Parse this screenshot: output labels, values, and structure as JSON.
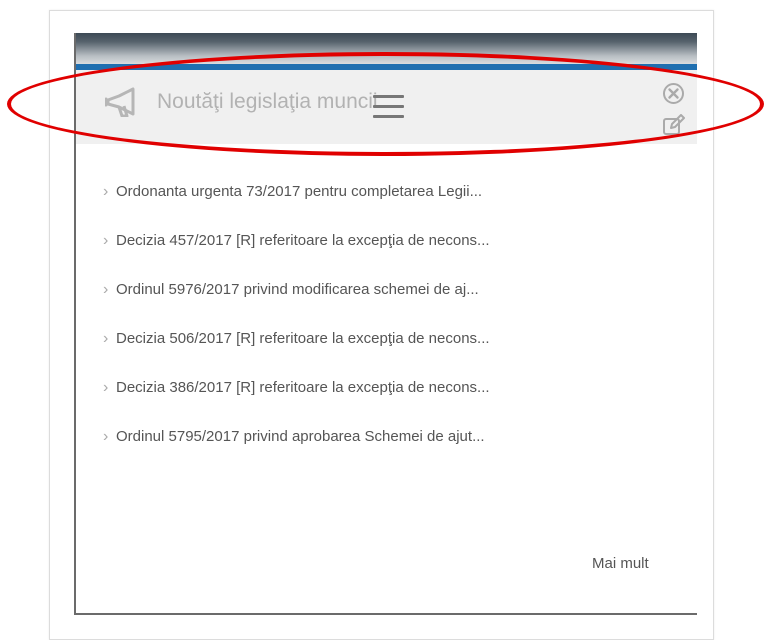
{
  "widget": {
    "title": "Noutăţi legislaţia muncii",
    "close_icon": "close-circle-icon",
    "edit_icon": "edit-icon",
    "drag_handle_icon": "drag-handle-icon",
    "megaphone_icon": "megaphone-icon"
  },
  "news": {
    "items": [
      "Ordonanta urgenta 73/2017 pentru completarea Legii...",
      "Decizia 457/2017 [R] referitoare la excepţia de necons...",
      "Ordinul 5976/2017 privind modificarea schemei de aj...",
      "Decizia 506/2017 [R] referitoare la excepţia de necons...",
      "Decizia 386/2017 [R] referitoare la excepţia de necons...",
      "Ordinul 5795/2017 privind aprobarea Schemei de ajut..."
    ],
    "arrow_icon": "chevron-right-icon",
    "more_label": "Mai mult"
  },
  "annotation": {
    "shape": "ellipse",
    "color": "#e00000"
  },
  "colors": {
    "accent": "#1f6fb0",
    "header_background": "#f0f0f0",
    "title_text": "#b2b2b2",
    "body_text": "#555555"
  }
}
